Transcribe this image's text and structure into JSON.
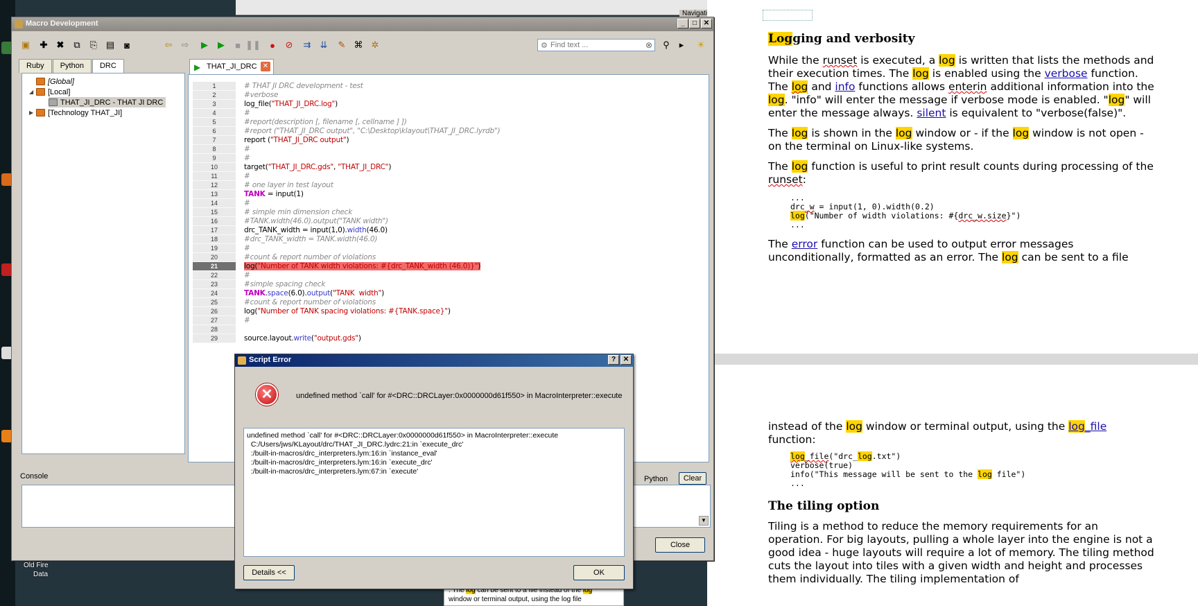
{
  "window": {
    "title": "Macro Development",
    "controls": [
      "_",
      "□",
      "✕"
    ]
  },
  "toolbar": {
    "find_placeholder": "Find text ..."
  },
  "left_tabs": [
    "Ruby",
    "Python",
    "DRC"
  ],
  "tree": [
    {
      "label": "[Global]",
      "italic": true
    },
    {
      "label": "[Local]"
    },
    {
      "label": "THAT_JI_DRC - THAT JI DRC"
    },
    {
      "label": "[Technology THAT_JI]"
    }
  ],
  "editor": {
    "tab_label": "THAT_JI_DRC",
    "line_numbers": [
      "1",
      "2",
      "3",
      "4",
      "5",
      "6",
      "7",
      "8",
      "9",
      "10",
      "11",
      "12",
      "13",
      "14",
      "15",
      "16",
      "17",
      "18",
      "19",
      "20",
      "21",
      "22",
      "23",
      "24",
      "25",
      "26",
      "27",
      "28",
      "29"
    ],
    "current_line": "21",
    "lines": [
      "# THAT JI DRC development - test",
      "#verbose",
      "log_file(\"THAT_JI_DRC.log\")",
      "#",
      "#report(description [, filename [, cellname ] ])",
      "#report (\"THAT_JI_DRC output\", \"C:\\Desktop\\klayout\\THAT_JI_DRC.lyrdb\")",
      "report (\"THAT_JI_DRC output\")",
      "#",
      "#",
      "target(\"THAT_JI_DRC.gds\", \"THAT_JI_DRC\")",
      "#",
      "# one layer in test layout",
      "TANK = input(1)",
      "#",
      "# simple min dimension check",
      "#TANK.width(46.0).output(\"TANK width\")",
      "drc_TANK_width = input(1,0).width(46.0)",
      "#drc_TANK_width = TANK.width(46.0)",
      "#",
      "#count & report number of violations",
      "log(\"Number of TANK width violations: #{drc_TANK_width (46.0)}\")",
      "#",
      "#simple spacing check",
      "TANK.space(6.0).output(\"TANK  width\")",
      "#count & report number of violations",
      "log(\"Number of TANK spacing violations: #{TANK.space}\")",
      "#",
      "",
      "source.layout.write(\"output.gds\")"
    ]
  },
  "console": {
    "label": "Console",
    "interpreter": "Python",
    "clear_label": "Clear",
    "close_label": "Close"
  },
  "dialog": {
    "title": "Script Error",
    "controls": [
      "?",
      "✕"
    ],
    "message": "undefined method `call' for #<DRC::DRCLayer:0x0000000d61f550> in MacroInterpreter::execute",
    "details": "undefined method `call' for #<DRC::DRCLayer:0x0000000d61f550> in MacroInterpreter::execute\n  C:/Users/jws/KLayout/drc/THAT_JI_DRC.lydrc:21:in `execute_drc'\n  :/built-in-macros/drc_interpreters.lym:16:in `instance_eval'\n  :/built-in-macros/drc_interpreters.lym:16:in `execute_drc'\n  :/built-in-macros/drc_interpreters.lym:67:in `execute'",
    "details_button": "Details <<",
    "ok_button": "OK"
  },
  "desktop": {
    "labels": [
      "Old Fire",
      "Data"
    ],
    "nav_title": "Navigation"
  },
  "doc_fragment": {
    "line1_a": ". The ",
    "line1_hl": "log",
    "line1_b": " can be sent to a file instead of the ",
    "line1_hl2": "log",
    "line2": "window or terminal output, using the log file"
  },
  "document": {
    "section1_title_hl": "Log",
    "section1_title_rest": "ging and verbosity",
    "code1": [
      "...",
      "drc_w = input(1, 0).width(0.2)",
      "log(\"Number of width violations: #{drc_w.size}\")",
      "..."
    ],
    "code2": [
      "log_file(\"drc_log.txt\")",
      "verbose(true)",
      "info(\"This message will be sent to the log file\")",
      "..."
    ],
    "section2_title": "The tiling option",
    "tiling_text": "Tiling is a method to reduce the memory requirements for an operation. For big layouts, pulling a whole layer into the engine is not a good idea - huge layouts will require a lot of memory. The tiling method cuts the layout into tiles with a given width and height and processes them individually. The tiling implementation of"
  },
  "colors": {
    "highlight": "#ffd400",
    "error_line": "#f26a6a",
    "link": "#1a0dab"
  }
}
